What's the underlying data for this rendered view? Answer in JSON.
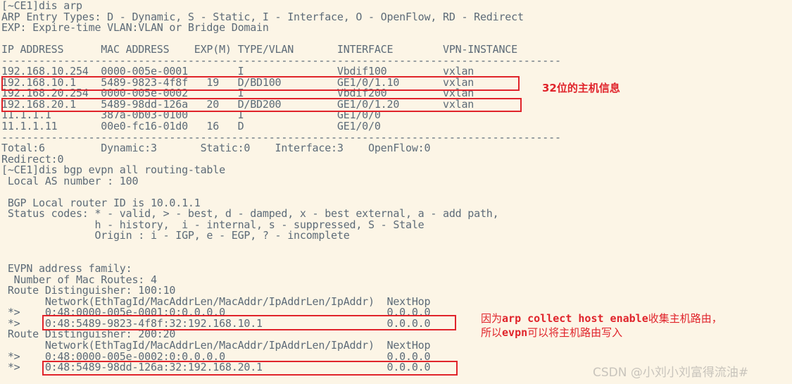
{
  "terminal": {
    "lines": [
      "[~CE1]dis arp",
      "ARP Entry Types: D - Dynamic, S - Static, I - Interface, O - OpenFlow, RD - Redirect",
      "EXP: Expire-time VLAN:VLAN or Bridge Domain",
      "",
      "IP ADDRESS      MAC ADDRESS    EXP(M) TYPE/VLAN       INTERFACE        VPN-INSTANCE",
      "------------------------------------------------------------------------------------------",
      "192.168.10.254  0000-005e-0001        I               Vbdif100         vxlan",
      "192.168.10.1    5489-9823-4f8f   19   D/BD100         GE1/0/1.10       vxlan",
      "192.168.20.254  0000-005e-0002        I               Vbdif200         vxlan",
      "192.168.20.1    5489-98dd-126a   20   D/BD200         GE1/0/1.20       vxlan",
      "11.1.1.1        387a-0b03-0100        I               GE1/0/0",
      "11.1.1.11       00e0-fc16-01d0   16   D               GE1/0/0",
      "------------------------------------------------------------------------------------------",
      "Total:6         Dynamic:3       Static:0    Interface:3    OpenFlow:0",
      "Redirect:0",
      "[~CE1]dis bgp evpn all routing-table",
      " Local AS number : 100",
      "",
      " BGP Local router ID is 10.0.1.1",
      " Status codes: * - valid, > - best, d - damped, x - best external, a - add path,",
      "               h - history,  i - internal, s - suppressed, S - Stale",
      "               Origin : i - IGP, e - EGP, ? - incomplete",
      "",
      "",
      " EVPN address family:",
      "  Number of Mac Routes: 4",
      " Route Distinguisher: 100:10",
      "       Network(EthTagId/MacAddrLen/MacAddr/IpAddrLen/IpAddr)  NextHop",
      " *>    0:48:0000-005e-0001:0:0.0.0.0                          0.0.0.0",
      " *>    0:48:5489-9823-4f8f:32:192.168.10.1                    0.0.0.0",
      " Route Distinguisher: 200:20",
      "       Network(EthTagId/MacAddrLen/MacAddr/IpAddrLen/IpAddr)  NextHop",
      " *>    0:48:0000-005e-0002:0:0.0.0.0                          0.0.0.0",
      " *>    0:48:5489-98dd-126a:32:192.168.20.1                    0.0.0.0"
    ]
  },
  "annotations": {
    "host_info": "32位的主机信息",
    "evpn_note_1_pre": "因为",
    "evpn_note_1_cmd": "arp collect host enable",
    "evpn_note_1_post": "收集主机路由，",
    "evpn_note_2_pre": "所以",
    "evpn_note_2_cmd": "evpn",
    "evpn_note_2_post": "可以将主机路由写入"
  },
  "watermark": "CSDN @小刘小刘富得流油#",
  "colors": {
    "background": "#fcf5e6",
    "text": "#5d6b78",
    "highlight": "#e0242b"
  }
}
